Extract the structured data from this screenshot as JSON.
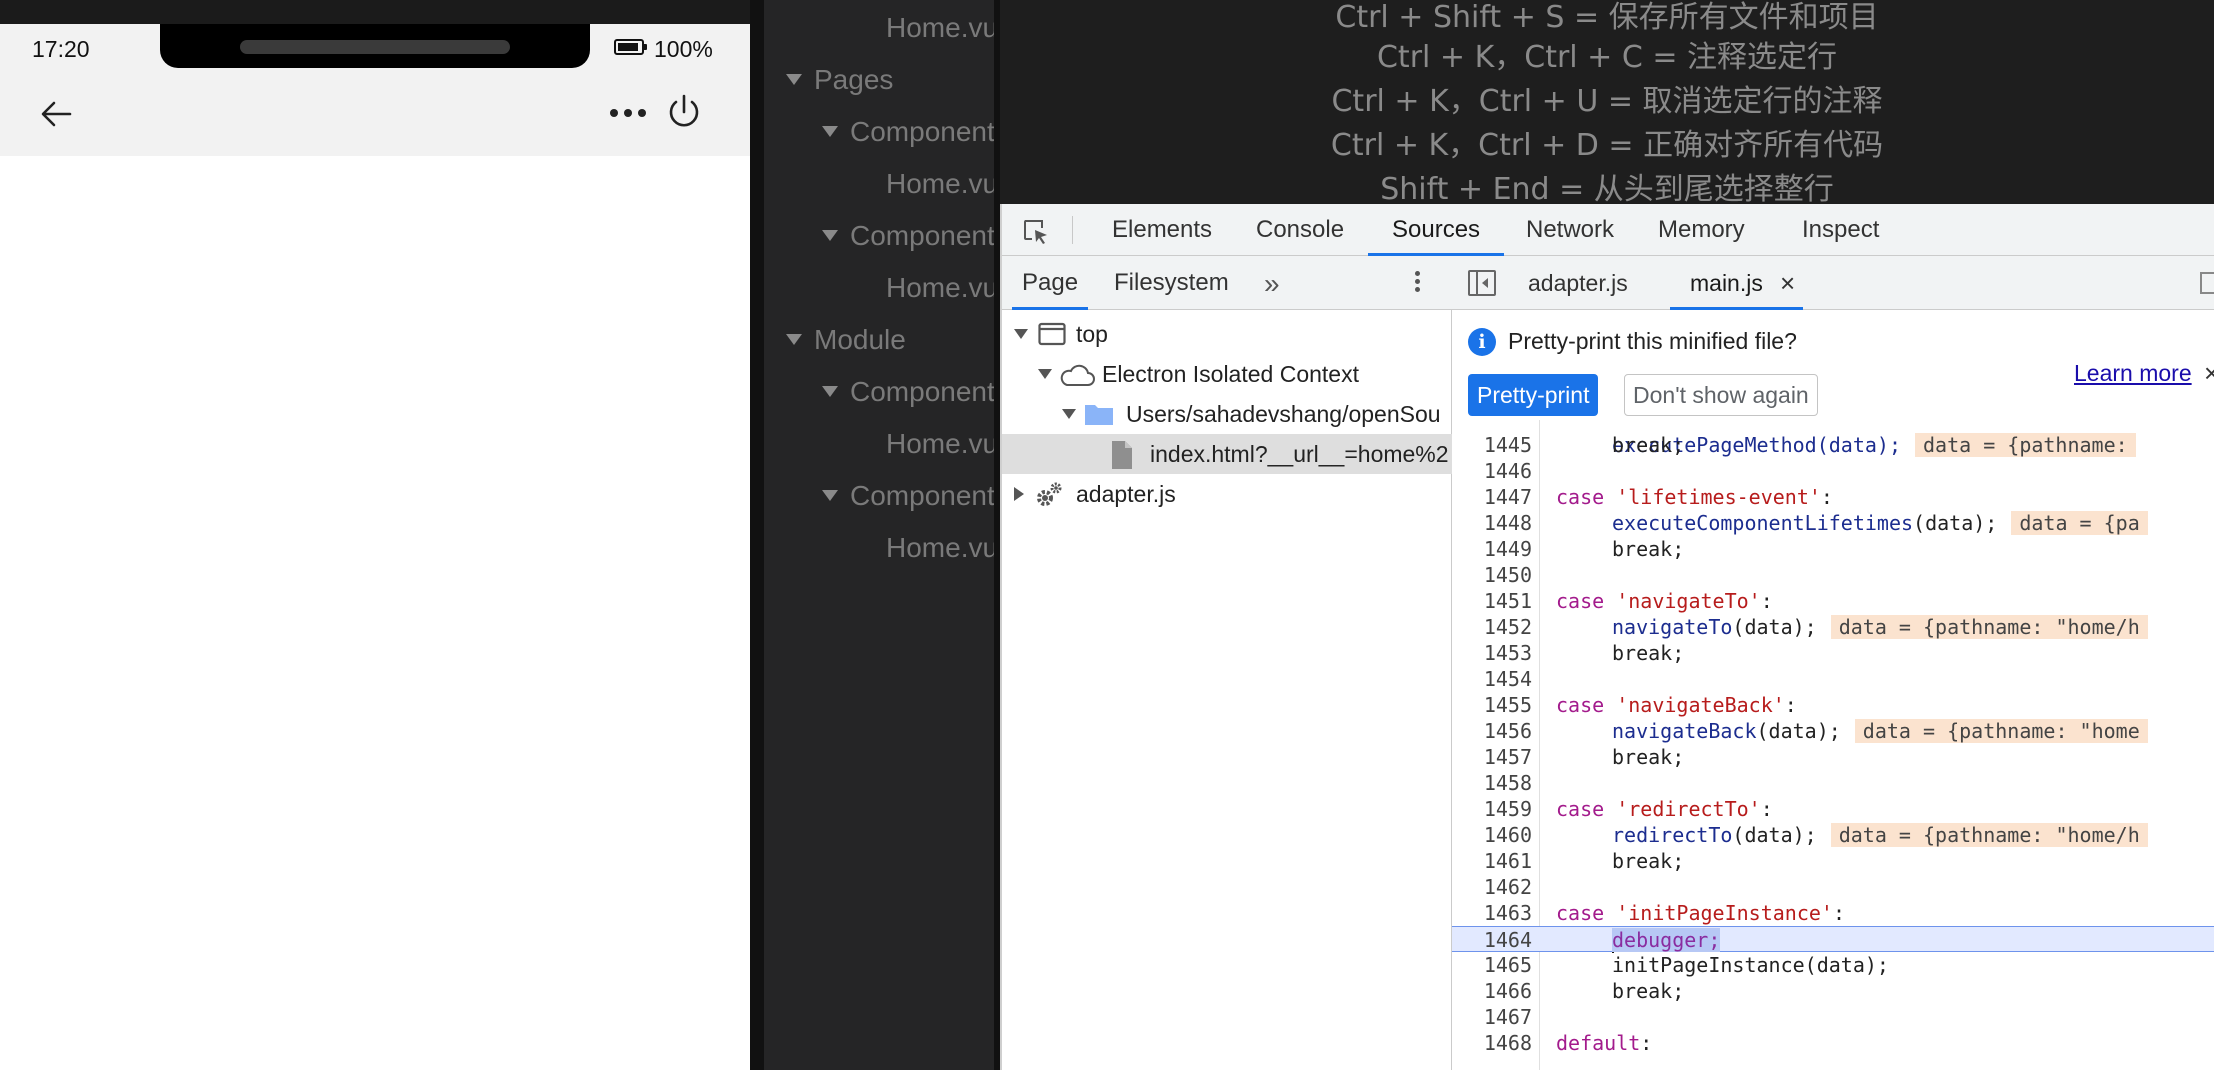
{
  "phone": {
    "time": "17:20",
    "battery": "100%"
  },
  "file_tree": [
    {
      "label": "Home.vu",
      "expanded": null
    },
    {
      "label": "Pages",
      "expanded": true
    },
    {
      "label": "Component",
      "expanded": true
    },
    {
      "label": "Home.vu",
      "expanded": null
    },
    {
      "label": "Component",
      "expanded": true
    },
    {
      "label": "Home.vu",
      "expanded": null
    },
    {
      "label": "Module",
      "expanded": true
    },
    {
      "label": "Component",
      "expanded": true
    },
    {
      "label": "Home.vu",
      "expanded": null
    },
    {
      "label": "Component",
      "expanded": true
    },
    {
      "label": "Home.vu",
      "expanded": null
    }
  ],
  "shortcuts": [
    "Ctrl + Shift + S = 保存所有文件和项目",
    "Ctrl + K，Ctrl + C = 注释选定行",
    "Ctrl + K，Ctrl + U = 取消选定行的注释",
    "Ctrl + K，Ctrl + D = 正确对齐所有代码",
    "Shift + End = 从头到尾选择整行"
  ],
  "devtools": {
    "tabs": [
      "Elements",
      "Console",
      "Sources",
      "Network",
      "Memory",
      "Inspect"
    ],
    "active_tab": "Sources",
    "navigator": {
      "tabs": [
        "Page",
        "Filesystem"
      ],
      "more": "»",
      "tree": [
        "top",
        "Electron Isolated Context",
        "Users/sahadevshang/openSou",
        "index.html?__url__=home%2",
        "adapter.js"
      ]
    },
    "file_tabs": [
      "adapter.js",
      "main.js"
    ],
    "close_glyph": "×",
    "info": {
      "message": "Pretty-print this minified file?",
      "learn_more": "Learn more",
      "primary": "Pretty-print",
      "secondary": "Don't show again"
    },
    "code": {
      "partial_line": "executePageMethod(data);",
      "partial_inline": "data = {pathname:",
      "lines": [
        {
          "n": "1445",
          "text": "break;"
        },
        {
          "n": "1446",
          "text": ""
        },
        {
          "n": "1447",
          "kw": "case",
          "str": "'lifetimes-event'",
          "end": ":"
        },
        {
          "n": "1448",
          "fn": "executeComponentLifetimes",
          "args": "(data);",
          "inline": "data = {pa"
        },
        {
          "n": "1449",
          "text": "break;"
        },
        {
          "n": "1450",
          "text": ""
        },
        {
          "n": "1451",
          "kw": "case",
          "str": "'navigateTo'",
          "end": ":"
        },
        {
          "n": "1452",
          "fn": "navigateTo",
          "args": "(data);",
          "inline": "data = {pathname: \"home/h"
        },
        {
          "n": "1453",
          "text": "break;"
        },
        {
          "n": "1454",
          "text": ""
        },
        {
          "n": "1455",
          "kw": "case",
          "str": "'navigateBack'",
          "end": ":"
        },
        {
          "n": "1456",
          "fn": "navigateBack",
          "args": "(data);",
          "inline": "data = {pathname: \"home"
        },
        {
          "n": "1457",
          "text": "break;"
        },
        {
          "n": "1458",
          "text": ""
        },
        {
          "n": "1459",
          "kw": "case",
          "str": "'redirectTo'",
          "end": ":"
        },
        {
          "n": "1460",
          "fn": "redirectTo",
          "args": "(data);",
          "inline": "data = {pathname: \"home/h"
        },
        {
          "n": "1461",
          "text": "break;"
        },
        {
          "n": "1462",
          "text": ""
        },
        {
          "n": "1463",
          "kw": "case",
          "str": "'initPageInstance'",
          "end": ":"
        },
        {
          "n": "1464",
          "debugger": "debugger;"
        },
        {
          "n": "1465",
          "text": "initPageInstance(data);"
        },
        {
          "n": "1466",
          "text": "break;"
        },
        {
          "n": "1467",
          "text": ""
        },
        {
          "n": "1468",
          "kw": "default",
          "end": ":"
        }
      ]
    }
  },
  "colors": {
    "accent": "#1a73e8",
    "keyword": "#a31b8c",
    "string": "#b71c1c",
    "function": "#1c2d8f",
    "inline_value_bg": "#fbe3cf",
    "breakpoint_line": "#e2e9ff"
  }
}
